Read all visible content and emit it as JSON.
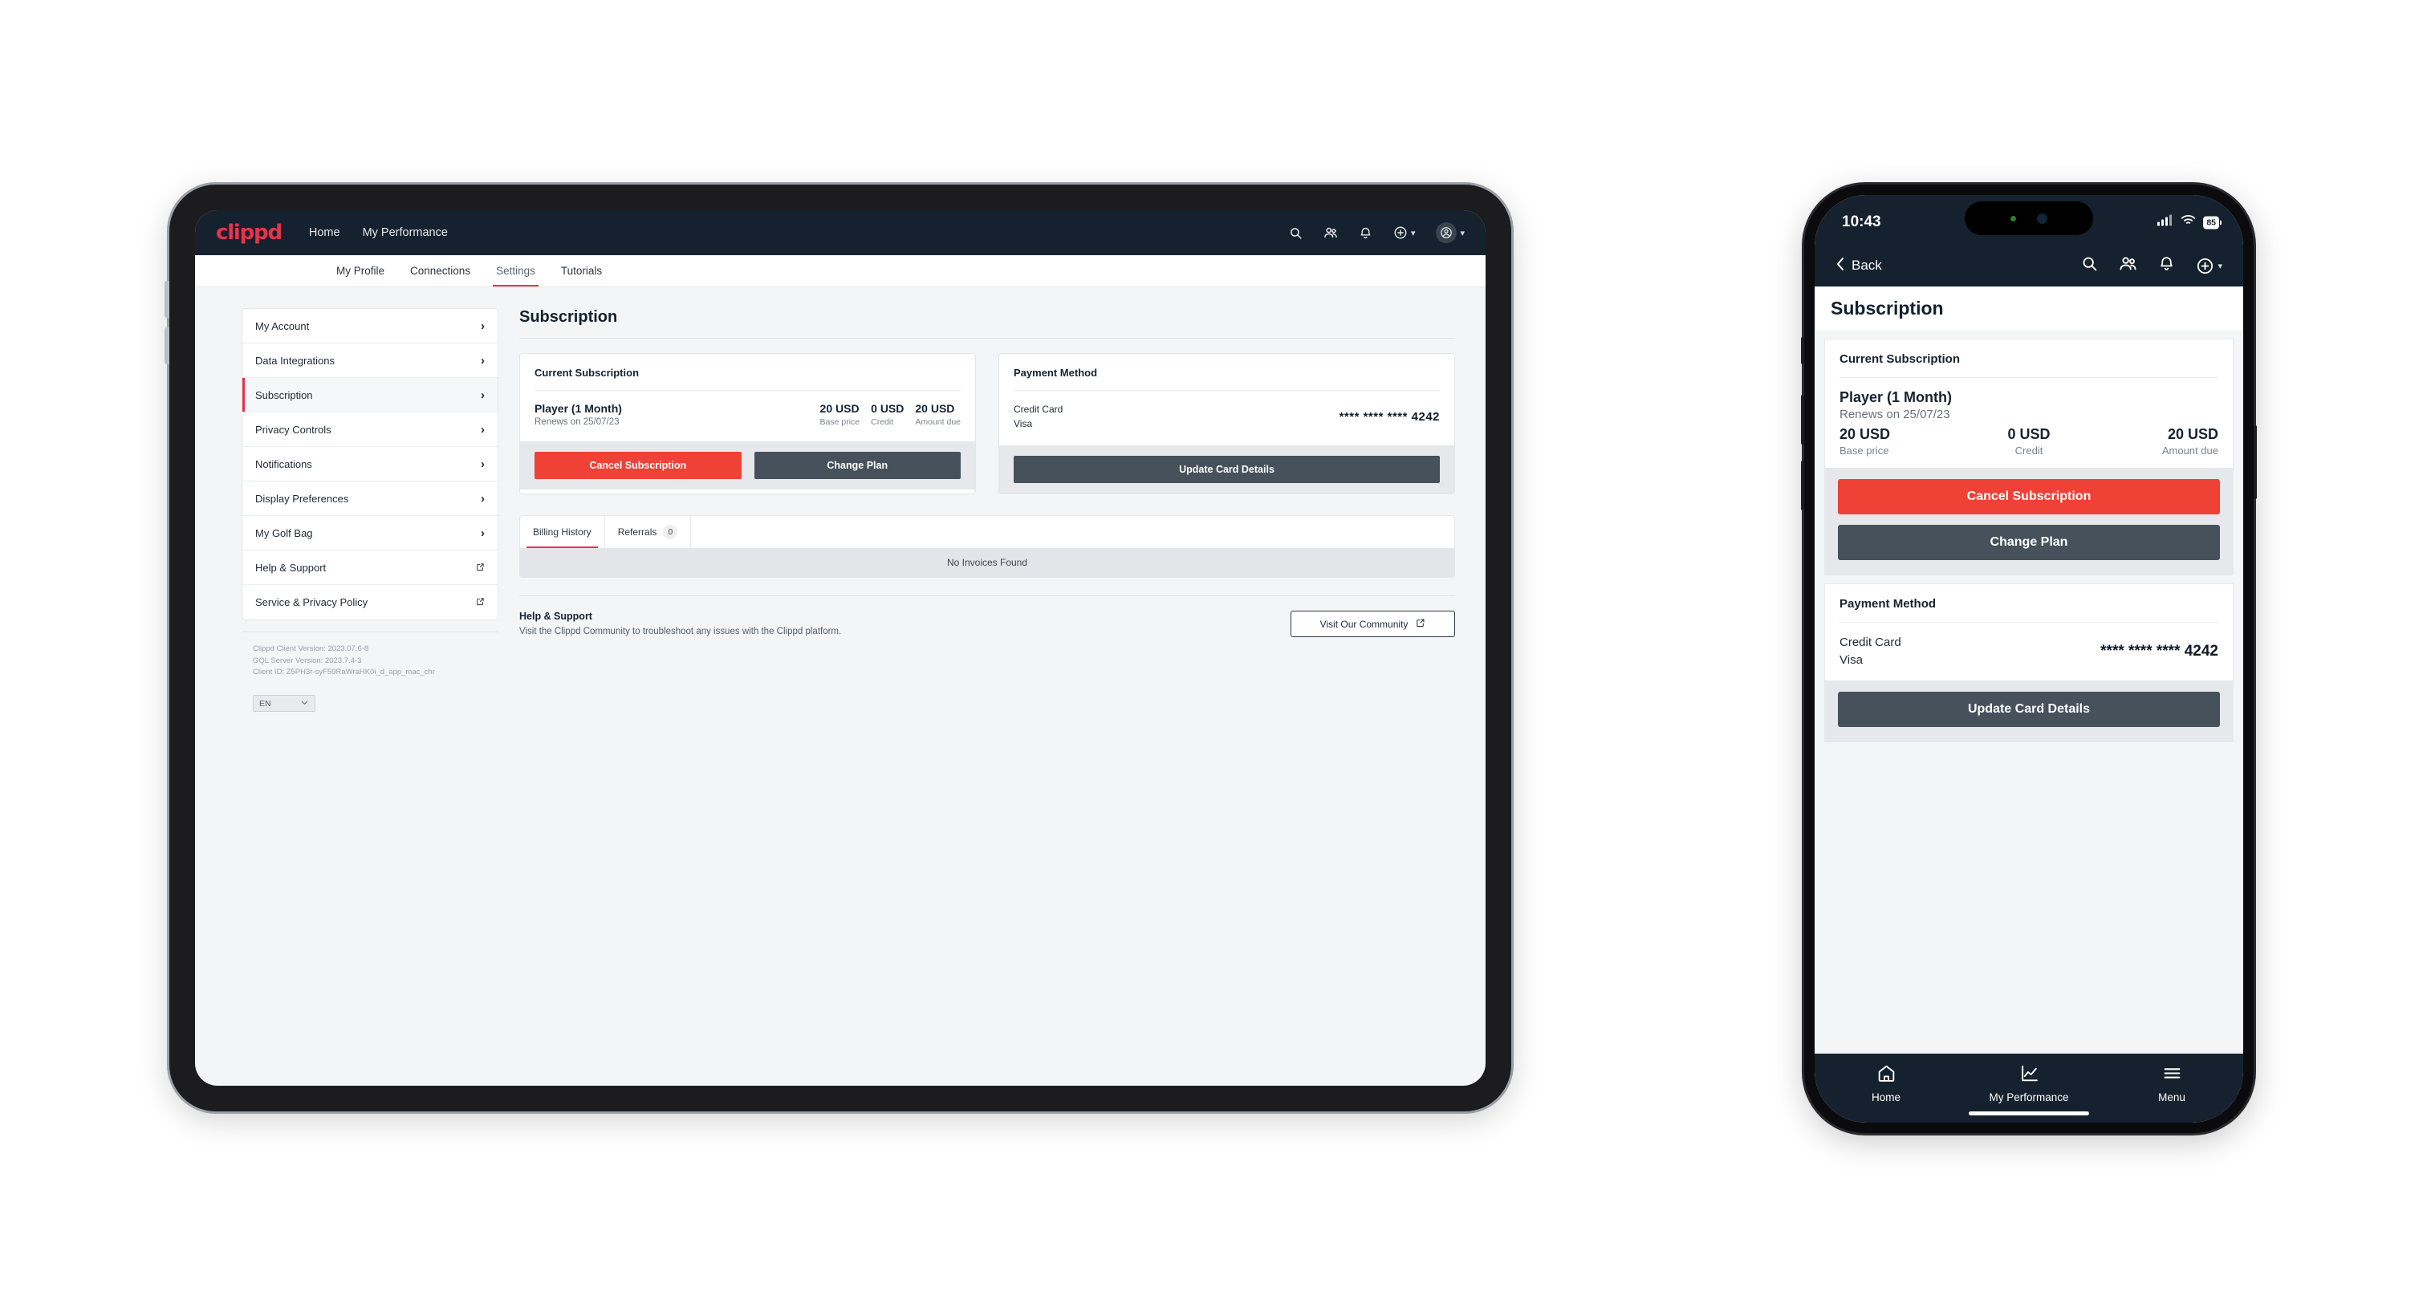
{
  "brand": {
    "name": "clippd",
    "accent": "#e8334a",
    "danger": "#ef4136",
    "dark": "#47515c",
    "navbar": "#15212e"
  },
  "tablet": {
    "topnav": {
      "links": [
        {
          "label": "Home"
        },
        {
          "label": "My Performance"
        }
      ],
      "icons": [
        "search-icon",
        "people-icon",
        "bell-icon",
        "plus-circle-icon",
        "avatar-icon"
      ]
    },
    "tabs": [
      {
        "label": "My Profile",
        "active": false
      },
      {
        "label": "Connections",
        "active": false
      },
      {
        "label": "Settings",
        "active": true
      },
      {
        "label": "Tutorials",
        "active": false
      }
    ],
    "sidebar": {
      "items": [
        {
          "label": "My Account",
          "external": false,
          "selected": false
        },
        {
          "label": "Data Integrations",
          "external": false,
          "selected": false
        },
        {
          "label": "Subscription",
          "external": false,
          "selected": true
        },
        {
          "label": "Privacy Controls",
          "external": false,
          "selected": false
        },
        {
          "label": "Notifications",
          "external": false,
          "selected": false
        },
        {
          "label": "Display Preferences",
          "external": false,
          "selected": false
        },
        {
          "label": "My Golf Bag",
          "external": false,
          "selected": false
        },
        {
          "label": "Help & Support",
          "external": true,
          "selected": false
        },
        {
          "label": "Service & Privacy Policy",
          "external": true,
          "selected": false
        }
      ],
      "version": {
        "client": "Clippd Client Version: 2023.07.6-8",
        "server": "GQL Server Version: 2023.7.4-3",
        "client_id": "Client ID: Z5PH3r-syF59RaWraHK0i_d_app_mac_chr"
      },
      "language": {
        "value": "EN"
      }
    },
    "main": {
      "page_title": "Subscription",
      "current_subscription": {
        "card_title": "Current Subscription",
        "plan_name": "Player (1 Month)",
        "renews": "Renews on 25/07/23",
        "metrics": [
          {
            "value": "20 USD",
            "label": "Base price"
          },
          {
            "value": "0 USD",
            "label": "Credit"
          },
          {
            "value": "20 USD",
            "label": "Amount due"
          }
        ],
        "cancel_label": "Cancel Subscription",
        "change_label": "Change Plan"
      },
      "payment_method": {
        "card_title": "Payment Method",
        "type": "Credit Card",
        "brand": "Visa",
        "number": "**** **** **** 4242",
        "update_label": "Update Card Details"
      },
      "billing": {
        "tabs": [
          {
            "label": "Billing History",
            "count": null,
            "active": true
          },
          {
            "label": "Referrals",
            "count": "0",
            "active": false
          }
        ],
        "empty_text": "No Invoices Found"
      },
      "help": {
        "heading": "Help & Support",
        "description": "Visit the Clippd Community to troubleshoot any issues with the Clippd platform.",
        "button_label": "Visit Our Community"
      }
    }
  },
  "phone": {
    "status": {
      "time": "10:43",
      "battery": "85"
    },
    "nav": {
      "back_label": "Back",
      "icons": [
        "search-icon",
        "people-icon",
        "bell-icon",
        "plus-circle-icon"
      ]
    },
    "page_title": "Subscription",
    "current_subscription": {
      "card_title": "Current Subscription",
      "plan_name": "Player (1 Month)",
      "renews": "Renews on 25/07/23",
      "metrics": [
        {
          "value": "20 USD",
          "label": "Base price"
        },
        {
          "value": "0 USD",
          "label": "Credit"
        },
        {
          "value": "20 USD",
          "label": "Amount due"
        }
      ],
      "cancel_label": "Cancel Subscription",
      "change_label": "Change Plan"
    },
    "payment_method": {
      "card_title": "Payment Method",
      "type": "Credit Card",
      "brand": "Visa",
      "number": "**** **** **** 4242",
      "update_label": "Update Card Details"
    },
    "tabbar": [
      {
        "label": "Home",
        "icon": "home-icon"
      },
      {
        "label": "My Performance",
        "icon": "chart-icon"
      },
      {
        "label": "Menu",
        "icon": "hamburger-icon"
      }
    ]
  }
}
